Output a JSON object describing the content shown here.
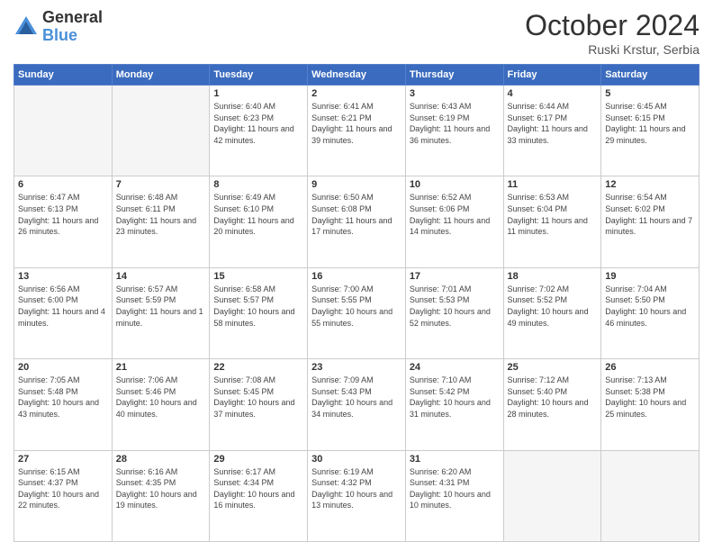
{
  "logo": {
    "general": "General",
    "blue": "Blue"
  },
  "title": "October 2024",
  "location": "Ruski Krstur, Serbia",
  "days_of_week": [
    "Sunday",
    "Monday",
    "Tuesday",
    "Wednesday",
    "Thursday",
    "Friday",
    "Saturday"
  ],
  "weeks": [
    [
      {
        "day": "",
        "empty": true
      },
      {
        "day": "",
        "empty": true
      },
      {
        "day": "1",
        "sunrise": "Sunrise: 6:40 AM",
        "sunset": "Sunset: 6:23 PM",
        "daylight": "Daylight: 11 hours and 42 minutes."
      },
      {
        "day": "2",
        "sunrise": "Sunrise: 6:41 AM",
        "sunset": "Sunset: 6:21 PM",
        "daylight": "Daylight: 11 hours and 39 minutes."
      },
      {
        "day": "3",
        "sunrise": "Sunrise: 6:43 AM",
        "sunset": "Sunset: 6:19 PM",
        "daylight": "Daylight: 11 hours and 36 minutes."
      },
      {
        "day": "4",
        "sunrise": "Sunrise: 6:44 AM",
        "sunset": "Sunset: 6:17 PM",
        "daylight": "Daylight: 11 hours and 33 minutes."
      },
      {
        "day": "5",
        "sunrise": "Sunrise: 6:45 AM",
        "sunset": "Sunset: 6:15 PM",
        "daylight": "Daylight: 11 hours and 29 minutes."
      }
    ],
    [
      {
        "day": "6",
        "sunrise": "Sunrise: 6:47 AM",
        "sunset": "Sunset: 6:13 PM",
        "daylight": "Daylight: 11 hours and 26 minutes."
      },
      {
        "day": "7",
        "sunrise": "Sunrise: 6:48 AM",
        "sunset": "Sunset: 6:11 PM",
        "daylight": "Daylight: 11 hours and 23 minutes."
      },
      {
        "day": "8",
        "sunrise": "Sunrise: 6:49 AM",
        "sunset": "Sunset: 6:10 PM",
        "daylight": "Daylight: 11 hours and 20 minutes."
      },
      {
        "day": "9",
        "sunrise": "Sunrise: 6:50 AM",
        "sunset": "Sunset: 6:08 PM",
        "daylight": "Daylight: 11 hours and 17 minutes."
      },
      {
        "day": "10",
        "sunrise": "Sunrise: 6:52 AM",
        "sunset": "Sunset: 6:06 PM",
        "daylight": "Daylight: 11 hours and 14 minutes."
      },
      {
        "day": "11",
        "sunrise": "Sunrise: 6:53 AM",
        "sunset": "Sunset: 6:04 PM",
        "daylight": "Daylight: 11 hours and 11 minutes."
      },
      {
        "day": "12",
        "sunrise": "Sunrise: 6:54 AM",
        "sunset": "Sunset: 6:02 PM",
        "daylight": "Daylight: 11 hours and 7 minutes."
      }
    ],
    [
      {
        "day": "13",
        "sunrise": "Sunrise: 6:56 AM",
        "sunset": "Sunset: 6:00 PM",
        "daylight": "Daylight: 11 hours and 4 minutes."
      },
      {
        "day": "14",
        "sunrise": "Sunrise: 6:57 AM",
        "sunset": "Sunset: 5:59 PM",
        "daylight": "Daylight: 11 hours and 1 minute."
      },
      {
        "day": "15",
        "sunrise": "Sunrise: 6:58 AM",
        "sunset": "Sunset: 5:57 PM",
        "daylight": "Daylight: 10 hours and 58 minutes."
      },
      {
        "day": "16",
        "sunrise": "Sunrise: 7:00 AM",
        "sunset": "Sunset: 5:55 PM",
        "daylight": "Daylight: 10 hours and 55 minutes."
      },
      {
        "day": "17",
        "sunrise": "Sunrise: 7:01 AM",
        "sunset": "Sunset: 5:53 PM",
        "daylight": "Daylight: 10 hours and 52 minutes."
      },
      {
        "day": "18",
        "sunrise": "Sunrise: 7:02 AM",
        "sunset": "Sunset: 5:52 PM",
        "daylight": "Daylight: 10 hours and 49 minutes."
      },
      {
        "day": "19",
        "sunrise": "Sunrise: 7:04 AM",
        "sunset": "Sunset: 5:50 PM",
        "daylight": "Daylight: 10 hours and 46 minutes."
      }
    ],
    [
      {
        "day": "20",
        "sunrise": "Sunrise: 7:05 AM",
        "sunset": "Sunset: 5:48 PM",
        "daylight": "Daylight: 10 hours and 43 minutes."
      },
      {
        "day": "21",
        "sunrise": "Sunrise: 7:06 AM",
        "sunset": "Sunset: 5:46 PM",
        "daylight": "Daylight: 10 hours and 40 minutes."
      },
      {
        "day": "22",
        "sunrise": "Sunrise: 7:08 AM",
        "sunset": "Sunset: 5:45 PM",
        "daylight": "Daylight: 10 hours and 37 minutes."
      },
      {
        "day": "23",
        "sunrise": "Sunrise: 7:09 AM",
        "sunset": "Sunset: 5:43 PM",
        "daylight": "Daylight: 10 hours and 34 minutes."
      },
      {
        "day": "24",
        "sunrise": "Sunrise: 7:10 AM",
        "sunset": "Sunset: 5:42 PM",
        "daylight": "Daylight: 10 hours and 31 minutes."
      },
      {
        "day": "25",
        "sunrise": "Sunrise: 7:12 AM",
        "sunset": "Sunset: 5:40 PM",
        "daylight": "Daylight: 10 hours and 28 minutes."
      },
      {
        "day": "26",
        "sunrise": "Sunrise: 7:13 AM",
        "sunset": "Sunset: 5:38 PM",
        "daylight": "Daylight: 10 hours and 25 minutes."
      }
    ],
    [
      {
        "day": "27",
        "sunrise": "Sunrise: 6:15 AM",
        "sunset": "Sunset: 4:37 PM",
        "daylight": "Daylight: 10 hours and 22 minutes."
      },
      {
        "day": "28",
        "sunrise": "Sunrise: 6:16 AM",
        "sunset": "Sunset: 4:35 PM",
        "daylight": "Daylight: 10 hours and 19 minutes."
      },
      {
        "day": "29",
        "sunrise": "Sunrise: 6:17 AM",
        "sunset": "Sunset: 4:34 PM",
        "daylight": "Daylight: 10 hours and 16 minutes."
      },
      {
        "day": "30",
        "sunrise": "Sunrise: 6:19 AM",
        "sunset": "Sunset: 4:32 PM",
        "daylight": "Daylight: 10 hours and 13 minutes."
      },
      {
        "day": "31",
        "sunrise": "Sunrise: 6:20 AM",
        "sunset": "Sunset: 4:31 PM",
        "daylight": "Daylight: 10 hours and 10 minutes."
      },
      {
        "day": "",
        "empty": true
      },
      {
        "day": "",
        "empty": true
      }
    ]
  ]
}
